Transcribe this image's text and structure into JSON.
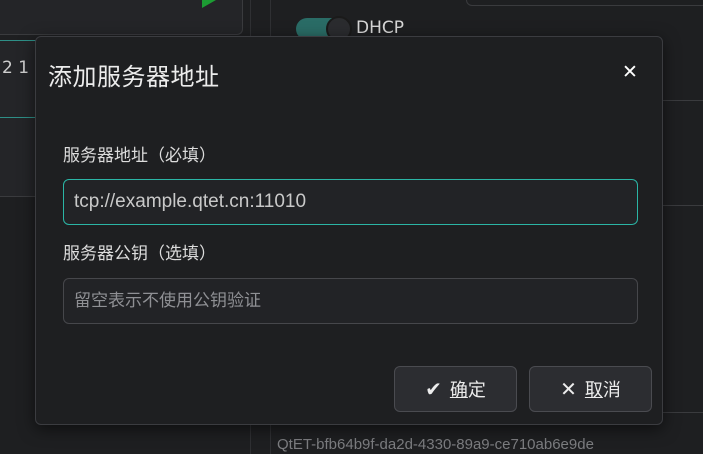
{
  "background": {
    "left_panel_fragment": "2 1",
    "toggle_label": "DHCP",
    "footer_id": "QtET-bfb64b9f-da2d-4330-89a9-ce710ab6e9de"
  },
  "dialog": {
    "title": "添加服务器地址",
    "close_icon": "close-icon",
    "server_address": {
      "label": "服务器地址（必填）",
      "placeholder": "tcp://example.qtet.cn:11010",
      "value": ""
    },
    "server_pubkey": {
      "label": "服务器公钥（选填）",
      "placeholder": "留空表示不使用公钥验证",
      "value": ""
    },
    "ok_button": {
      "icon": "check-icon",
      "label_first": "确",
      "label_rest": "定"
    },
    "cancel_button": {
      "icon": "close-icon",
      "label_first": "取",
      "label_rest": "消"
    }
  },
  "colors": {
    "accent": "#2bb5a5",
    "background": "#1e1f21",
    "play": "#1c9c33"
  }
}
